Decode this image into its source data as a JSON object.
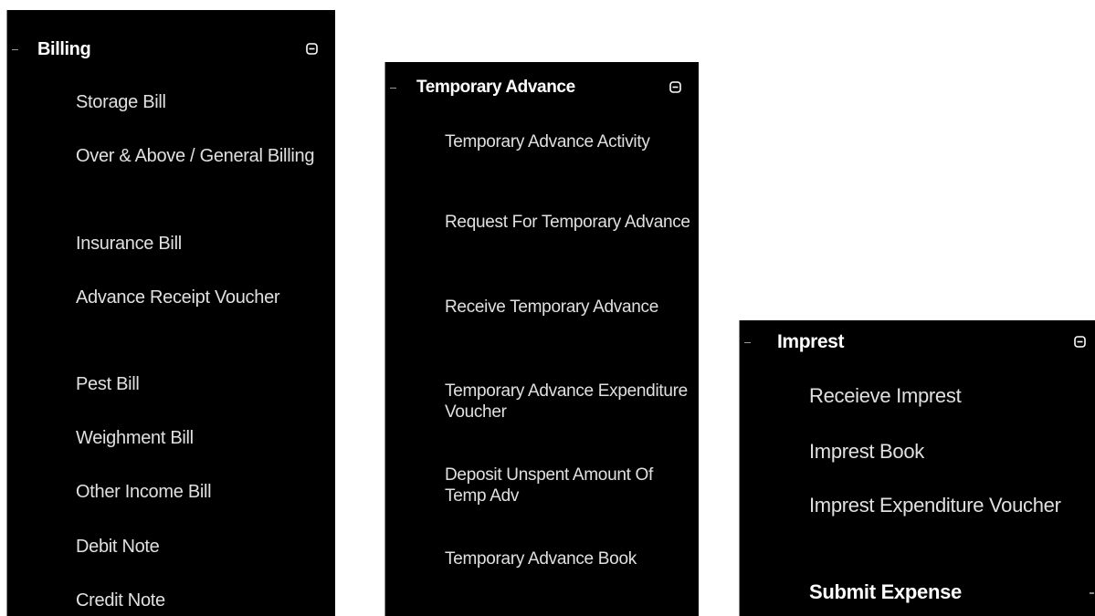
{
  "panels": [
    {
      "title": "Billing",
      "toggle_icon": "collapse-minus-box",
      "items": [
        {
          "label": "Storage Bill"
        },
        {
          "label": "Over & Above / General Billing"
        },
        {
          "label": "Insurance Bill"
        },
        {
          "label": "Advance Receipt Voucher"
        },
        {
          "label": "Pest Bill"
        },
        {
          "label": "Weighment Bill"
        },
        {
          "label": "Other Income Bill"
        },
        {
          "label": "Debit Note"
        },
        {
          "label": "Credit Note"
        }
      ]
    },
    {
      "title": "Temporary Advance",
      "toggle_icon": "collapse-minus-box",
      "items": [
        {
          "label": "Temporary Advance Activity"
        },
        {
          "label": "Request For Temporary Advance"
        },
        {
          "label": "Receive Temporary Advance"
        },
        {
          "label": "Temporary Advance Expenditure Voucher"
        },
        {
          "label": "Deposit Unspent Amount Of Temp Adv"
        },
        {
          "label": "Temporary Advance Book"
        }
      ]
    },
    {
      "title": "Imprest",
      "toggle_icon": "collapse-minus-box",
      "items": [
        {
          "label": "Receieve Imprest"
        },
        {
          "label": "Imprest Book"
        },
        {
          "label": "Imprest Expenditure Voucher"
        },
        {
          "label": "Submit Expense",
          "active": true
        }
      ]
    }
  ],
  "colors": {
    "panel_bg": "#000000",
    "text": "#e0e0e0",
    "title": "#ffffff",
    "page_bg": "#ffffff"
  }
}
